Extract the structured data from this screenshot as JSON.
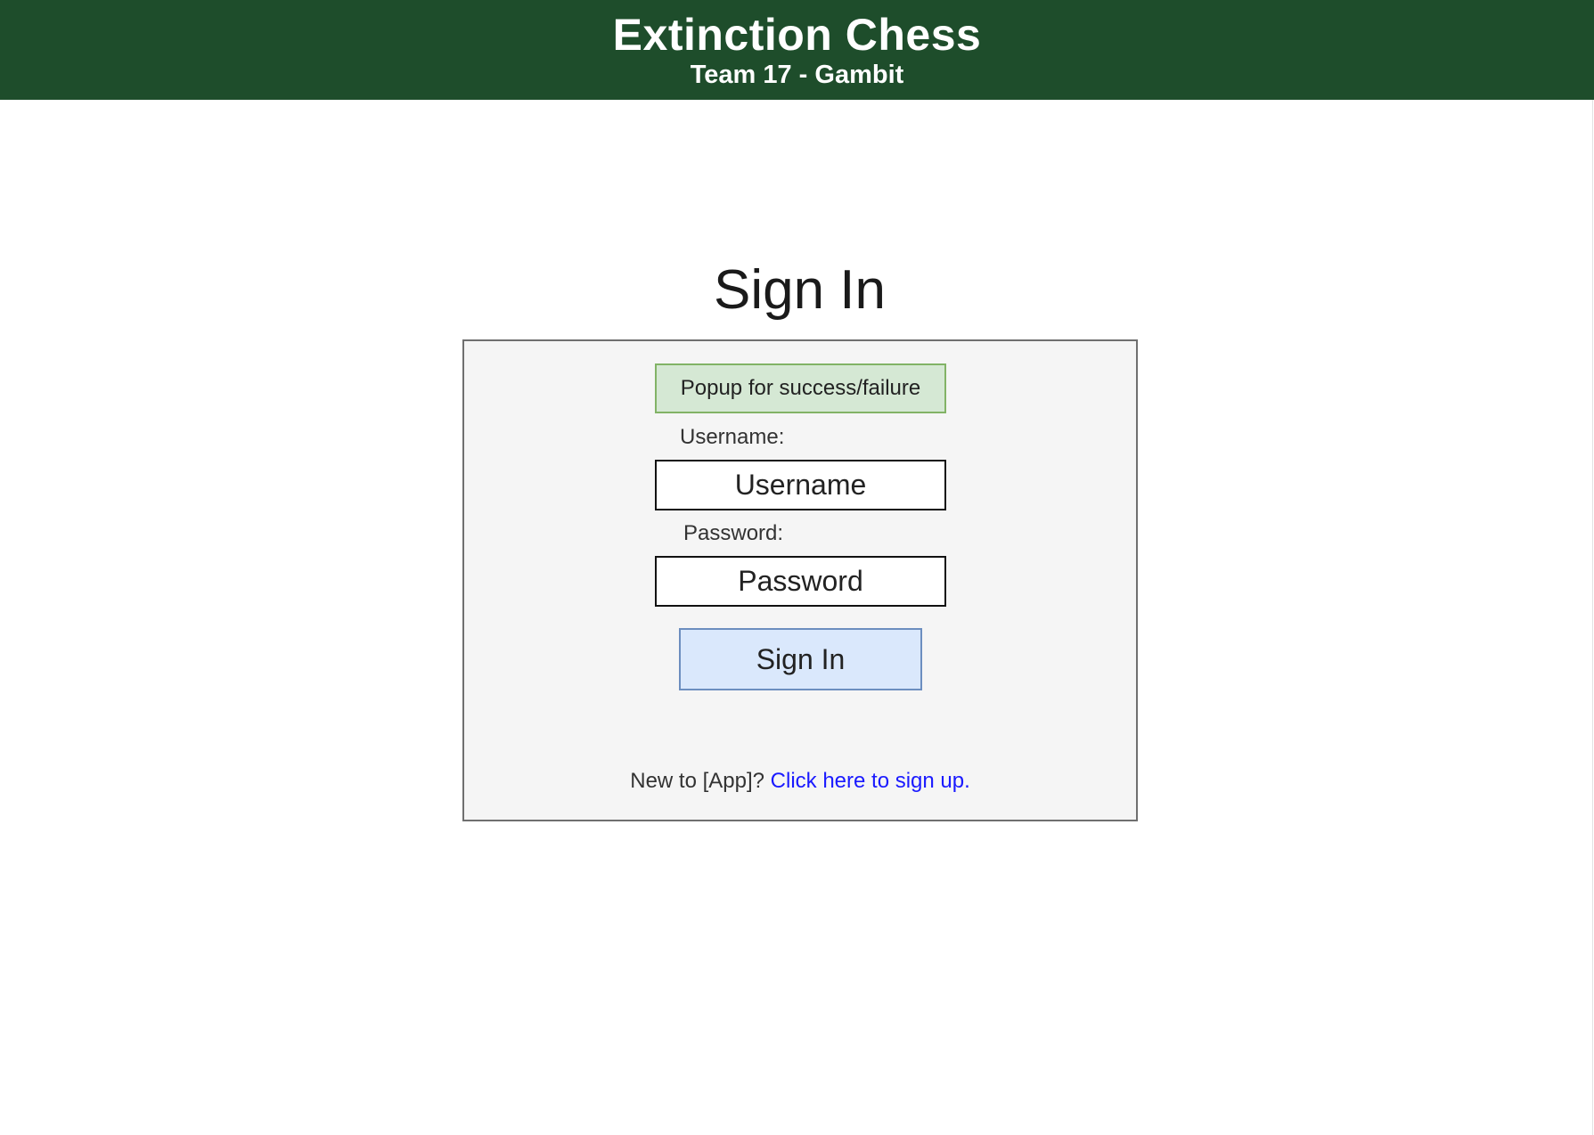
{
  "header": {
    "title": "Extinction Chess",
    "subtitle": "Team 17 - Gambit",
    "background_color": "#1e4d2b"
  },
  "page": {
    "heading": "Sign In"
  },
  "form": {
    "popup_text": "Popup for success/failure",
    "username_label": "Username:",
    "username_placeholder": "Username",
    "password_label": "Password:",
    "password_placeholder": "Password",
    "submit_label": "Sign In",
    "signup_prompt": "New to [App]?",
    "signup_link_text": "Click here to sign up."
  },
  "colors": {
    "popup_fill": "#d5e8d4",
    "popup_border": "#82b366",
    "button_fill": "#dae8fc",
    "button_border": "#6c8ebf",
    "link": "#1a1aff"
  }
}
